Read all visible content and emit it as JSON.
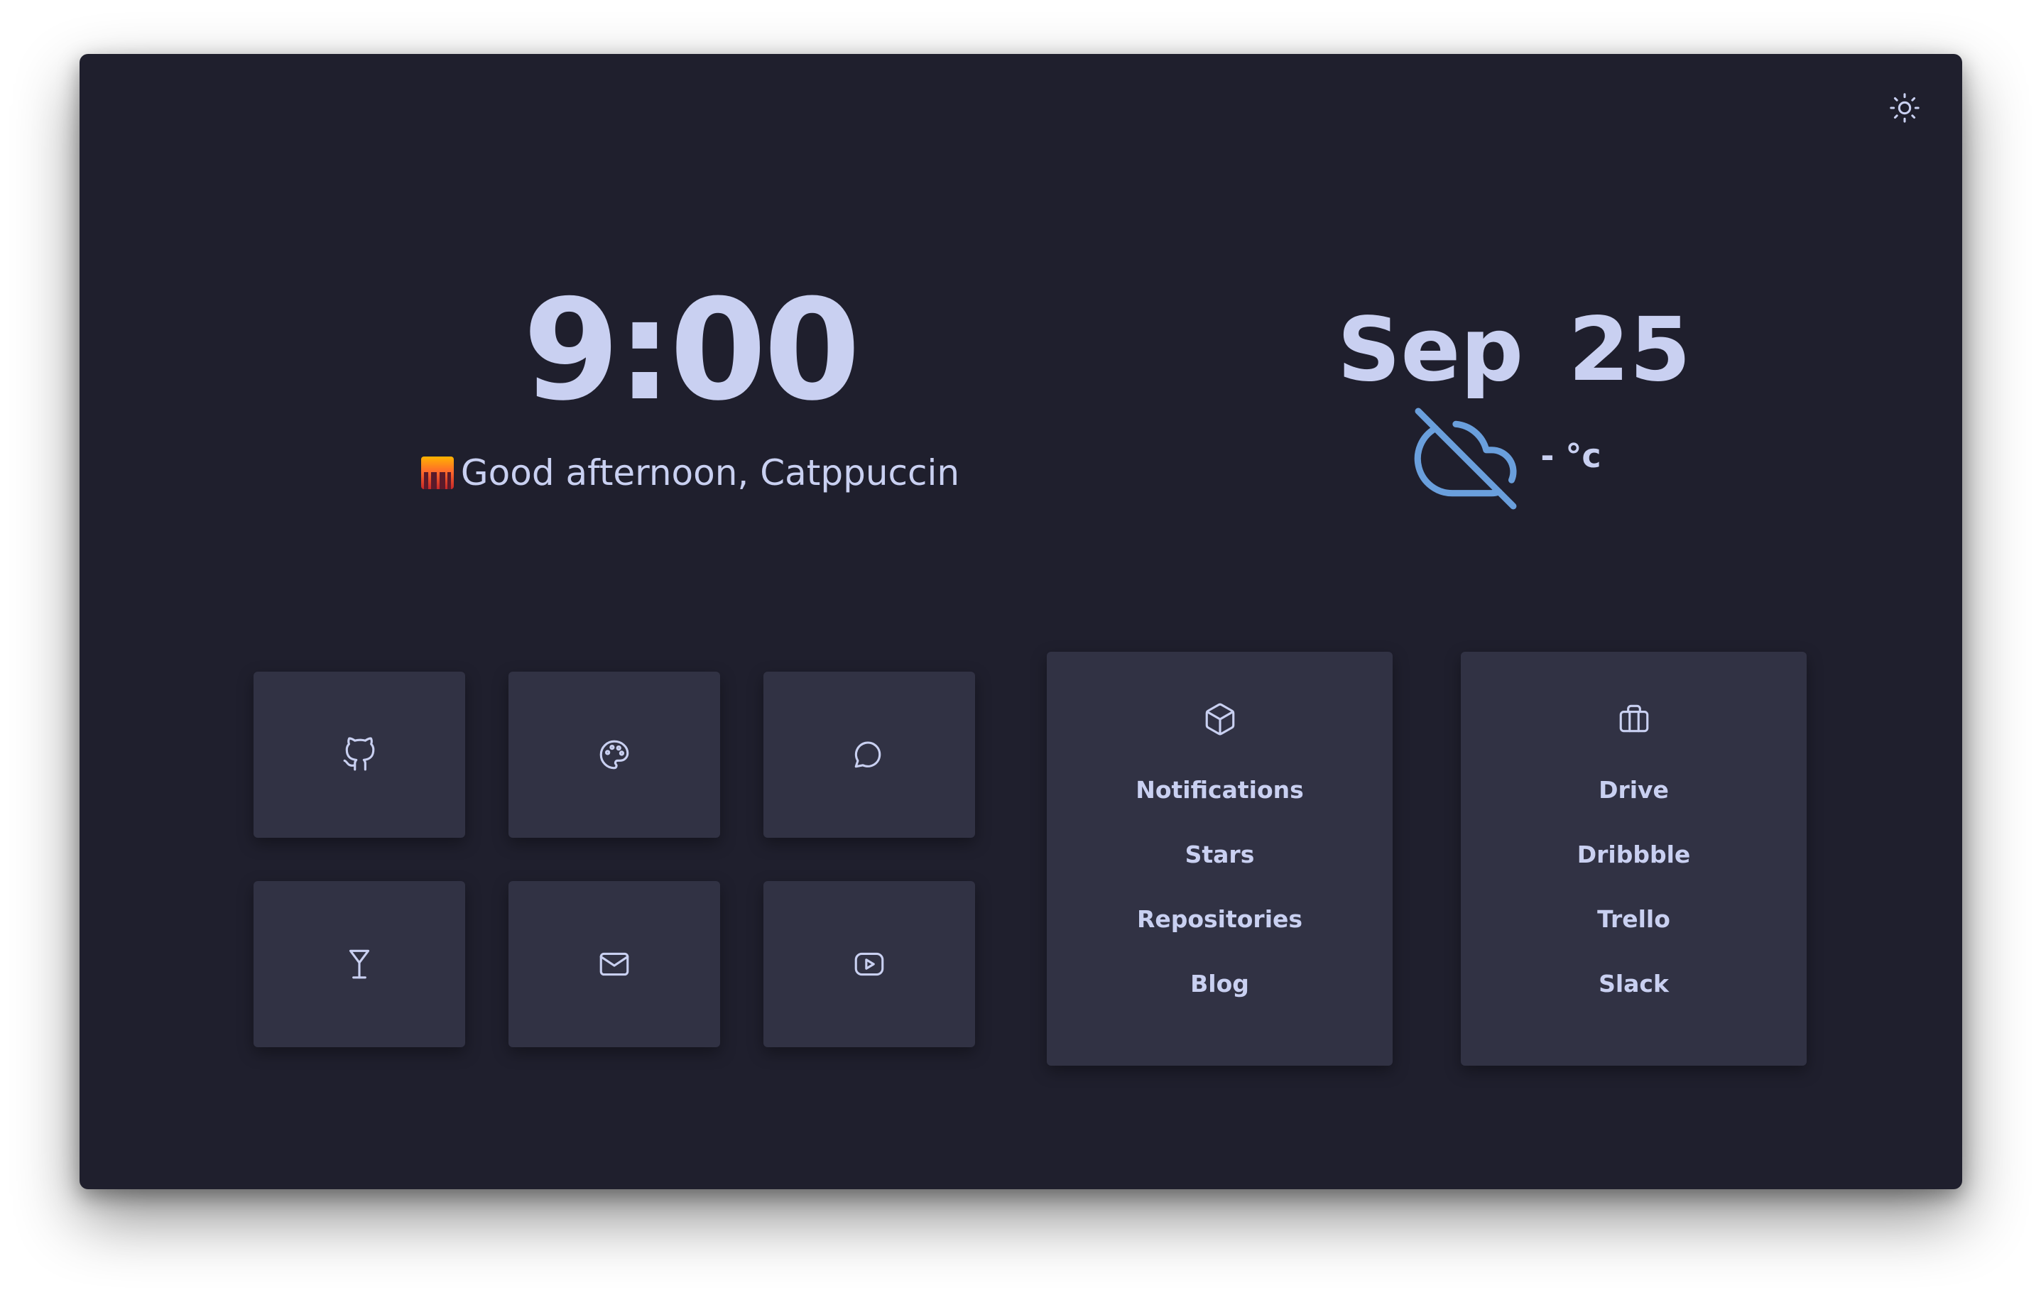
{
  "clock": {
    "time": "9:00"
  },
  "greeting": {
    "text": "Good afternoon, Catppuccin"
  },
  "date": {
    "text": "Sep 25"
  },
  "weather": {
    "temperature": "- °c",
    "icon": "cloud-off-icon",
    "icon_color": "#6a9fdc"
  },
  "theme_toggle": {
    "icon": "sun-icon"
  },
  "colors": {
    "background": "#1f1f2d",
    "tile": "#313244",
    "text": "#c9d0f1"
  },
  "shortcuts": [
    {
      "icon": "github-icon"
    },
    {
      "icon": "palette-icon"
    },
    {
      "icon": "message-circle-icon"
    },
    {
      "icon": "cocktail-icon"
    },
    {
      "icon": "mail-icon"
    },
    {
      "icon": "youtube-icon"
    }
  ],
  "cards": [
    {
      "icon": "box-icon",
      "links": [
        "Notifications",
        "Stars",
        "Repositories",
        "Blog"
      ]
    },
    {
      "icon": "briefcase-icon",
      "links": [
        "Drive",
        "Dribbble",
        "Trello",
        "Slack"
      ]
    }
  ]
}
